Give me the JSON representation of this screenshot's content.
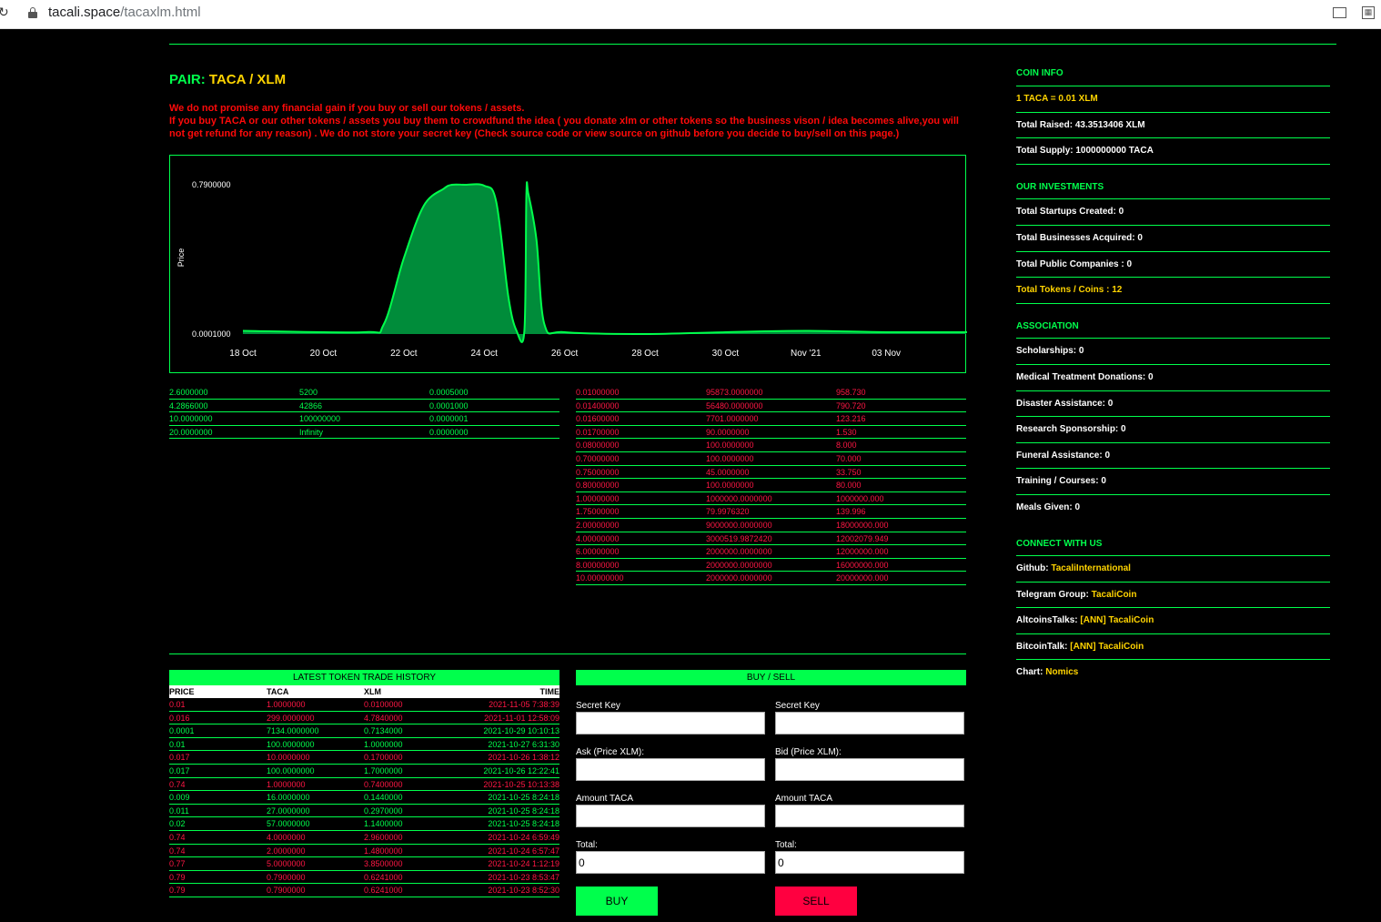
{
  "browser": {
    "url_host": "tacali.space",
    "url_path": "/tacaxlm.html"
  },
  "pair": {
    "label": "PAIR:",
    "base": "TACA",
    "sep": "/",
    "quote": "XLM"
  },
  "warning": {
    "line1": "We do not promise any financial gain if you buy or sell our tokens / assets.",
    "line2": "If you buy TACA or our other tokens / assets you buy them to crowdfund the idea ( you donate xlm or other tokens so the business vison / idea becomes alive,you will not get refund for any reason) . We do not store your secret key (Check source code or view source on github before you decide to buy/sell on this page.)"
  },
  "chart_data": {
    "type": "area",
    "ylabel": "Price",
    "y_ticks": [
      "0.7900000",
      "0.0001000"
    ],
    "ylim": [
      0.0001,
      0.79
    ],
    "x_ticks": [
      "18 Oct",
      "20 Oct",
      "22 Oct",
      "24 Oct",
      "26 Oct",
      "28 Oct",
      "30 Oct",
      "Nov '21",
      "03 Nov"
    ],
    "color": "#00ff4c",
    "fill": "#008c3a",
    "series": [
      {
        "x": [
          "2021-10-18",
          "2021-10-21",
          "2021-10-21.5",
          "2021-10-22",
          "2021-10-22.5",
          "2021-10-23",
          "2021-10-23.2",
          "2021-10-23.5",
          "2021-10-24",
          "2021-10-24.3",
          "2021-10-24.6",
          "2021-10-24.8",
          "2021-10-25",
          "2021-10-25.05",
          "2021-10-25.1",
          "2021-10-25.3",
          "2021-10-25.5",
          "2021-10-26",
          "2021-10-28",
          "2021-10-30",
          "2021-11-01",
          "2021-11-03",
          "2021-11-05"
        ],
        "values": [
          0.017,
          0.01,
          0.05,
          0.4,
          0.68,
          0.77,
          0.79,
          0.79,
          0.785,
          0.7,
          0.2,
          0.02,
          0.017,
          0.74,
          0.74,
          0.5,
          0.05,
          0.01,
          0.0001,
          0.01,
          0.017,
          0.01,
          0.01
        ]
      }
    ]
  },
  "bids": [
    [
      "2.6000000",
      "5200",
      "0.0005000"
    ],
    [
      "4.2866000",
      "42866",
      "0.0001000"
    ],
    [
      "10.0000000",
      "100000000",
      "0.0000001"
    ],
    [
      "20.0000000",
      "Infinity",
      "0.0000000"
    ]
  ],
  "asks": [
    [
      "0.01000000",
      "95873.0000000",
      "958.730"
    ],
    [
      "0.01400000",
      "56480.0000000",
      "790.720"
    ],
    [
      "0.01600000",
      "7701.0000000",
      "123.216"
    ],
    [
      "0.01700000",
      "90.0000000",
      "1.530"
    ],
    [
      "0.08000000",
      "100.0000000",
      "8.000"
    ],
    [
      "0.70000000",
      "100.0000000",
      "70.000"
    ],
    [
      "0.75000000",
      "45.0000000",
      "33.750"
    ],
    [
      "0.80000000",
      "100.0000000",
      "80.000"
    ],
    [
      "1.00000000",
      "1000000.0000000",
      "1000000.000"
    ],
    [
      "1.75000000",
      "79.9976320",
      "139.996"
    ],
    [
      "2.00000000",
      "9000000.0000000",
      "18000000.000"
    ],
    [
      "4.00000000",
      "3000519.9872420",
      "12002079.949"
    ],
    [
      "6.00000000",
      "2000000.0000000",
      "12000000.000"
    ],
    [
      "8.00000000",
      "2000000.0000000",
      "16000000.000"
    ],
    [
      "10.00000000",
      "2000000.0000000",
      "20000000.000"
    ]
  ],
  "history": {
    "title": "LATEST TOKEN TRADE HISTORY",
    "columns": [
      "PRICE",
      "TACA",
      "XLM",
      "TIME"
    ],
    "rows": [
      {
        "price": "0.01",
        "taca": "1.0000000",
        "xlm": "0.0100000",
        "time": "2021-11-05 7:38:39",
        "side": "sell"
      },
      {
        "price": "0.016",
        "taca": "299.0000000",
        "xlm": "4.7840000",
        "time": "2021-11-01 12:58:09",
        "side": "sell"
      },
      {
        "price": "0.0001",
        "taca": "7134.0000000",
        "xlm": "0.7134000",
        "time": "2021-10-29 10:10:13",
        "side": "buy"
      },
      {
        "price": "0.01",
        "taca": "100.0000000",
        "xlm": "1.0000000",
        "time": "2021-10-27 6:31:30",
        "side": "buy"
      },
      {
        "price": "0.017",
        "taca": "10.0000000",
        "xlm": "0.1700000",
        "time": "2021-10-26 1:38:12",
        "side": "sell"
      },
      {
        "price": "0.017",
        "taca": "100.0000000",
        "xlm": "1.7000000",
        "time": "2021-10-26 12:22:41",
        "side": "buy"
      },
      {
        "price": "0.74",
        "taca": "1.0000000",
        "xlm": "0.7400000",
        "time": "2021-10-25 10:13:38",
        "side": "sell"
      },
      {
        "price": "0.009",
        "taca": "16.0000000",
        "xlm": "0.1440000",
        "time": "2021-10-25 8:24:18",
        "side": "buy"
      },
      {
        "price": "0.011",
        "taca": "27.0000000",
        "xlm": "0.2970000",
        "time": "2021-10-25 8:24:18",
        "side": "buy"
      },
      {
        "price": "0.02",
        "taca": "57.0000000",
        "xlm": "1.1400000",
        "time": "2021-10-25 8:24:18",
        "side": "buy"
      },
      {
        "price": "0.74",
        "taca": "4.0000000",
        "xlm": "2.9600000",
        "time": "2021-10-24 6:59:49",
        "side": "sell"
      },
      {
        "price": "0.74",
        "taca": "2.0000000",
        "xlm": "1.4800000",
        "time": "2021-10-24 6:57:47",
        "side": "sell"
      },
      {
        "price": "0.77",
        "taca": "5.0000000",
        "xlm": "3.8500000",
        "time": "2021-10-24 1:12:19",
        "side": "sell"
      },
      {
        "price": "0.79",
        "taca": "0.7900000",
        "xlm": "0.6241000",
        "time": "2021-10-23 8:53:47",
        "side": "sell"
      },
      {
        "price": "0.79",
        "taca": "0.7900000",
        "xlm": "0.6241000",
        "time": "2021-10-23 8:52:30",
        "side": "sell"
      }
    ]
  },
  "buysell": {
    "title": "BUY / SELL",
    "buy": {
      "secret_label": "Secret Key",
      "price_label": "Ask (Price XLM):",
      "amount_label": "Amount TACA",
      "total_label": "Total:",
      "total_value": "0",
      "button": "BUY",
      "color": "#00ff4c"
    },
    "sell": {
      "secret_label": "Secret Key",
      "price_label": "Bid (Price XLM):",
      "amount_label": "Amount TACA",
      "total_label": "Total:",
      "total_value": "0",
      "button": "SELL",
      "color": "#ff0040"
    }
  },
  "sidebar": {
    "coin_info_title": "COIN INFO",
    "rate_prefix": "1 TACA = ",
    "rate_value": "0.01 XLM",
    "total_raised": "Total Raised: 43.3513406 XLM",
    "total_supply": "Total Supply: 1000000000 TACA",
    "investments_title": "OUR INVESTMENTS",
    "startups": "Total Startups Created: 0",
    "businesses": "Total Businesses Acquired: 0",
    "public_companies": "Total Public Companies : 0",
    "tokens": "Total Tokens / Coins : 12",
    "association_title": "ASSOCIATION",
    "scholarships": "Scholarships: 0",
    "medical": "Medical Treatment Donations: 0",
    "disaster": "Disaster Assistance: 0",
    "research": "Research Sponsorship: 0",
    "funeral": "Funeral Assistance: 0",
    "training": "Training / Courses: 0",
    "meals": "Meals Given: 0",
    "connect_title": "CONNECT WITH US",
    "github_label": "Github: ",
    "github_link": "TacaliInternational",
    "telegram_label": "Telegram Group: ",
    "telegram_link": "TacaliCoin",
    "altcoins_label": "AltcoinsTalks: ",
    "altcoins_link": "[ANN] TacaliCoin",
    "bitcoin_label": "BitcoinTalk: ",
    "bitcoin_link": "[ANN] TacaliCoin",
    "chart_label": "Chart: ",
    "chart_link": "Nomics"
  }
}
